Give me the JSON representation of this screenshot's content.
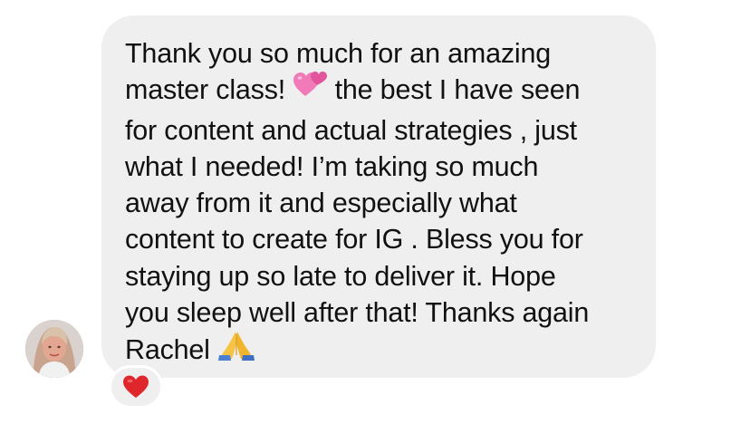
{
  "message": {
    "lines": [
      {
        "text": "Thank you so much for an amazing"
      },
      {
        "before": "master class! ",
        "icon": "two-hearts-emoji",
        "after": " the best I have seen"
      },
      {
        "text": "for content and actual strategies , just"
      },
      {
        "text": "what I needed! I’m taking so much"
      },
      {
        "text": "away from it and especially what"
      },
      {
        "text": "content to create for IG . Bless you for"
      },
      {
        "text": "staying up so late to deliver it. Hope"
      },
      {
        "text": "you sleep well after that! Thanks again"
      },
      {
        "before": "Rachel ",
        "icon": "folded-hands-emoji"
      }
    ],
    "bubble_color": "#efeff0",
    "text_color": "#111111"
  },
  "sender": {
    "avatar_icon": "user-avatar"
  },
  "reaction": {
    "icon": "red-heart-emoji",
    "color": "#e0262d"
  }
}
